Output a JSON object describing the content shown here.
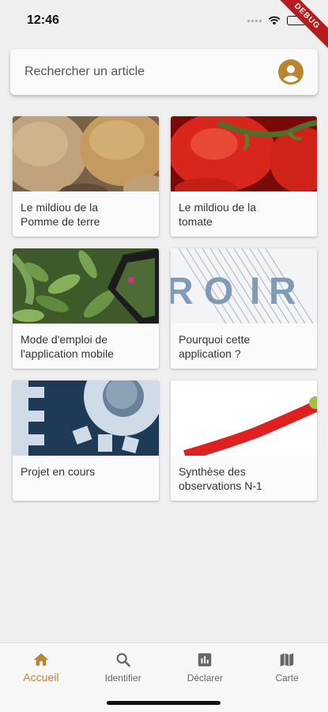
{
  "status": {
    "time": "12:46",
    "debug": "DEBUG"
  },
  "search": {
    "placeholder": "Rechercher un article"
  },
  "colors": {
    "accent": "#b8862e",
    "debug": "#b71c1c"
  },
  "articles": [
    {
      "title": "Le mildiou de la\nPomme de terre",
      "image": "potatoes"
    },
    {
      "title": "Le mildiou de la\ntomate",
      "image": "tomatoes"
    },
    {
      "title": "Mode d'emploi de\nl'application mobile",
      "image": "plant-phone"
    },
    {
      "title": "Pourquoi cette\napplication ?",
      "image": "text-paper"
    },
    {
      "title": "Projet en cours",
      "image": "gear"
    },
    {
      "title": "Synthèse des\nobservations N-1",
      "image": "red-curve"
    }
  ],
  "nav": [
    {
      "label": "Accueil",
      "icon": "home-icon",
      "active": true
    },
    {
      "label": "Identifier",
      "icon": "search-icon",
      "active": false
    },
    {
      "label": "Déclarer",
      "icon": "bar-chart-icon",
      "active": false
    },
    {
      "label": "Carte",
      "icon": "map-icon",
      "active": false
    }
  ]
}
